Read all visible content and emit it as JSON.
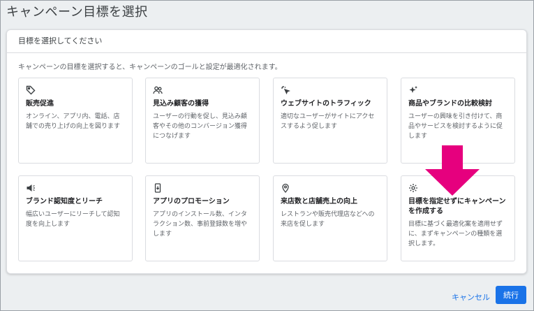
{
  "page": {
    "title": "キャンペーン目標を選択"
  },
  "dialog": {
    "header": "目標を選択してください",
    "description": "キャンペーンの目標を選択すると、キャンペーンのゴールと設定が最適化されます。"
  },
  "cards": [
    {
      "icon": "tag-icon",
      "title": "販売促進",
      "desc": "オンライン、アプリ内、電話、店舗での売り上げの向上を図ります"
    },
    {
      "icon": "people-icon",
      "title": "見込み顧客の獲得",
      "desc": "ユーザーの行動を促し、見込み顧客やその他のコンバージョン獲得につなげます"
    },
    {
      "icon": "click-icon",
      "title": "ウェブサイトのトラフィック",
      "desc": "適切なユーザーがサイトにアクセスするよう促します"
    },
    {
      "icon": "sparkle-icon",
      "title": "商品やブランドの比較検討",
      "desc": "ユーザーの興味を引き付けて、商品やサービスを検討するように促します"
    },
    {
      "icon": "megaphone-icon",
      "title": "ブランド認知度とリーチ",
      "desc": "幅広いユーザーにリーチして認知度を向上します"
    },
    {
      "icon": "phone-icon",
      "title": "アプリのプロモーション",
      "desc": "アプリのインストール数、インタラクション数、事前登録数を増やします"
    },
    {
      "icon": "location-icon",
      "title": "来店数と店舗売上の向上",
      "desc": "レストランや販売代理店などへの来店を促します"
    },
    {
      "icon": "gear-icon",
      "title": "目標を指定せずにキャンペーンを作成する",
      "desc": "目標に基づく最適化案を適用せずに、まずキャンペーンの種類を選択します。"
    }
  ],
  "footer": {
    "cancel": "キャンセル",
    "continue": "続行"
  },
  "colors": {
    "accent": "#1a73e8",
    "arrow": "#e6007e"
  }
}
